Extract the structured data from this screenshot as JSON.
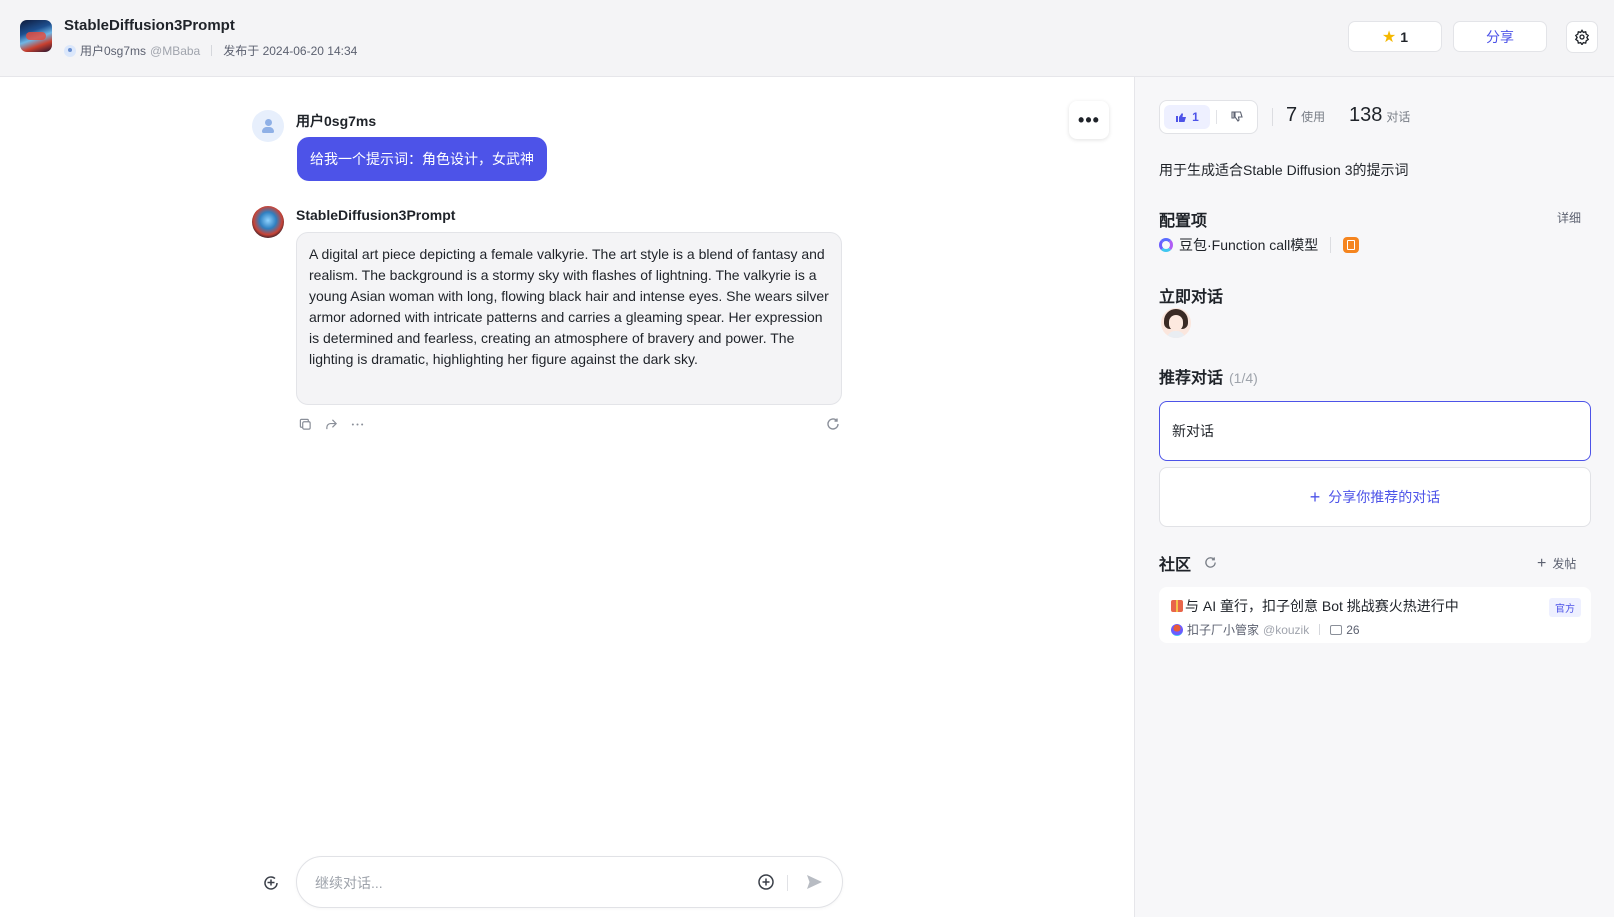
{
  "header": {
    "bot_title": "StableDiffusion3Prompt",
    "author_name": "用户0sg7ms",
    "author_handle": "@MBaba",
    "published": "发布于 2024-06-20 14:34",
    "star_count": "1",
    "share_label": "分享",
    "icons": {
      "logo": "bot-logo",
      "star": "star-icon",
      "settings": "gear-icon"
    }
  },
  "chat": {
    "more_label": "•••",
    "messages": [
      {
        "role": "user",
        "name": "用户0sg7ms",
        "text": "给我一个提示词：角色设计，女武神"
      },
      {
        "role": "bot",
        "name": "StableDiffusion3Prompt",
        "text": "A digital art piece depicting a female valkyrie. The art style is a blend of fantasy and realism. The background is a stormy sky with flashes of lightning. The valkyrie is a young Asian woman with long, flowing black hair and intense eyes. She wears silver armor adorned with intricate patterns and carries a gleaming spear. Her expression is determined and fearless, creating an atmosphere of bravery and power. The lighting is dramatic, highlighting her figure against the dark sky."
      }
    ],
    "message_actions": [
      "copy-icon",
      "share-icon",
      "more-icon",
      "regenerate-icon"
    ],
    "input_placeholder": "继续对话...",
    "input_value": ""
  },
  "panel": {
    "like_count": "1",
    "usage_count": "7",
    "usage_label": "使用",
    "conversation_count": "138",
    "conversation_label": "对话",
    "description": "用于生成适合Stable Diffusion 3的提示词",
    "config_title": "配置项",
    "config_detail": "详细",
    "model_name": "豆包·Function call模型",
    "chat_now_title": "立即对话",
    "recommended_title": "推荐对话",
    "recommended_count": "(1/4)",
    "recommended_item": "新对话",
    "share_recommended": "分享你推荐的对话",
    "community_title": "社区",
    "post_label": "发帖",
    "community_post": {
      "title": "与 AI 童行，扣子创意 Bot 挑战赛火热进行中",
      "badge": "官方",
      "author": "扣子厂小管家",
      "handle": "@kouzik",
      "comments": "26"
    }
  },
  "colors": {
    "accent": "#4d53e8",
    "star": "#f5b800",
    "plugin": "#f5851f"
  }
}
